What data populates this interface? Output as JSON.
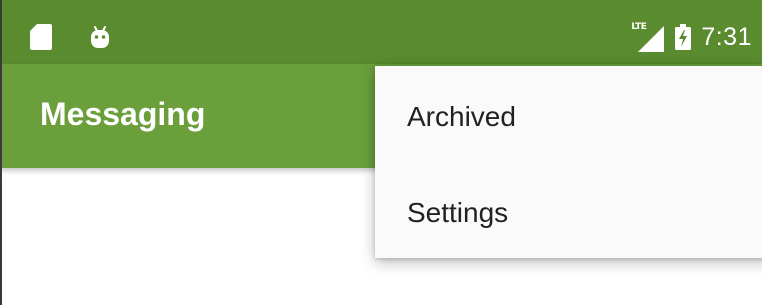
{
  "status_bar": {
    "left_icons": [
      "sd-card-icon",
      "android-icon"
    ],
    "network_label": "LTE",
    "time": "7:31"
  },
  "app_bar": {
    "title": "Messaging"
  },
  "overflow_menu": {
    "items": [
      {
        "label": "Archived"
      },
      {
        "label": "Settings"
      }
    ]
  },
  "colors": {
    "status_bar": "#5a8b2e",
    "app_bar": "#6a9f3c",
    "menu_background": "#fafafa",
    "menu_text": "#212121"
  }
}
